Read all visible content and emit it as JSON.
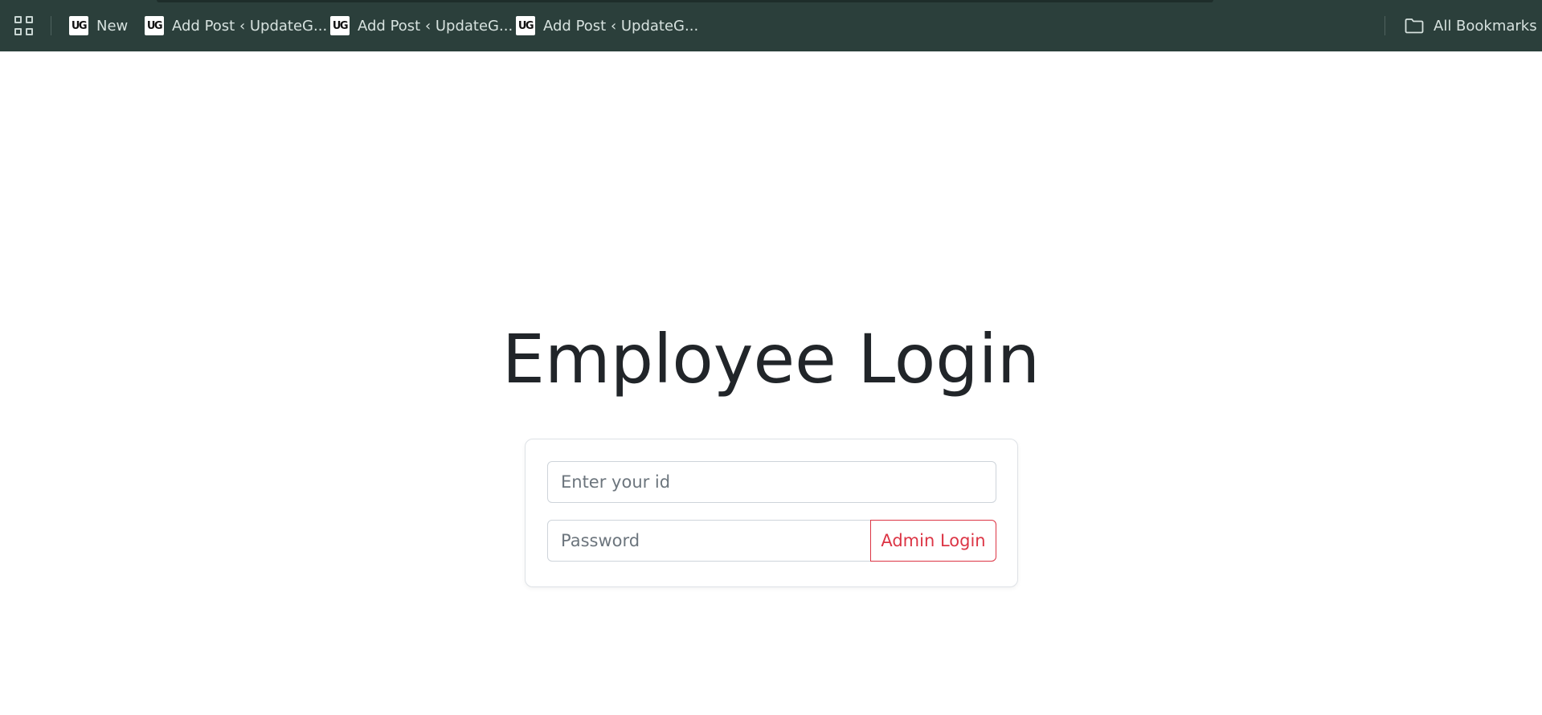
{
  "bookmarks_bar": {
    "items": [
      {
        "label": "New",
        "icon": "ug-favicon",
        "icon_text": "UG"
      },
      {
        "label": "Add Post ‹ UpdateG...",
        "icon": "ug-favicon",
        "icon_text": "UG"
      },
      {
        "label": "Add Post ‹ UpdateG...",
        "icon": "ug-favicon",
        "icon_text": "UG"
      },
      {
        "label": "Add Post ‹ UpdateG...",
        "icon": "ug-favicon",
        "icon_text": "UG"
      }
    ],
    "all_bookmarks_label": "All Bookmarks",
    "background_color": "#2b3f3b"
  },
  "page": {
    "title": "Employee Login"
  },
  "login_form": {
    "id_input": {
      "value": "",
      "placeholder": "Enter your id"
    },
    "password_input": {
      "value": "",
      "placeholder": "Password"
    },
    "admin_button_label": "Admin Login",
    "accent_color": "#dc3545"
  }
}
